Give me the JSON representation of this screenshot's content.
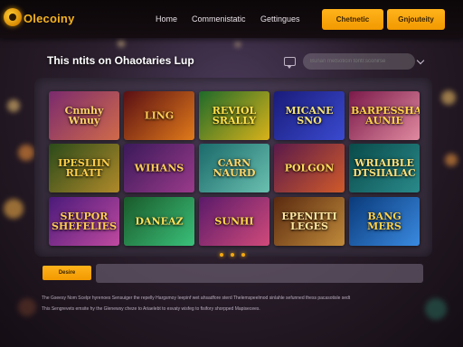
{
  "header": {
    "logo_text": "Olecoiny",
    "nav": [
      "Home",
      "Commenistatic",
      "Gettingues"
    ],
    "btn_primary": "Chetnetic",
    "btn_secondary": "Gnjouteity"
  },
  "hero": {
    "headline": "This ntits on Ohaotaries Lup",
    "search_placeholder": "Bunan metsoticin tontr.sconirse"
  },
  "games": [
    {
      "label": "Cnmhy Wnuy",
      "colors": [
        "#7a2a6e",
        "#d06a4a"
      ],
      "text": "#ffd36a"
    },
    {
      "label": "LING",
      "colors": [
        "#5a0f14",
        "#e07a1a"
      ],
      "text": "#ffcc55"
    },
    {
      "label": "REVIOL SRALLY",
      "colors": [
        "#1e6a2a",
        "#d9b21a"
      ],
      "text": "#ffe24a"
    },
    {
      "label": "MICANE SNO",
      "colors": [
        "#1a1c7a",
        "#3a4ad0"
      ],
      "text": "#f4e37a"
    },
    {
      "label": "BARPESSHA AUNIE",
      "colors": [
        "#7a1a4a",
        "#e08aa0"
      ],
      "text": "#ffd24a"
    },
    {
      "label": "IPESLIIN RLATT",
      "colors": [
        "#2a4a1a",
        "#b08a2a"
      ],
      "text": "#ffcf4a"
    },
    {
      "label": "WIHANS",
      "colors": [
        "#3a1a5a",
        "#9a3a8a"
      ],
      "text": "#ffce5a"
    },
    {
      "label": "CARN NAURD",
      "colors": [
        "#1a6a6a",
        "#6ac0b0"
      ],
      "text": "#ffd86a"
    },
    {
      "label": "POLGON",
      "colors": [
        "#5a1a4a",
        "#d05a2a"
      ],
      "text": "#ffdc5a"
    },
    {
      "label": "WRIAIBLE DTSIIALAC",
      "colors": [
        "#0a4a4a",
        "#2a8a8a"
      ],
      "text": "#ffe07a"
    },
    {
      "label": "SEUPOR SHEFELIES",
      "colors": [
        "#4a1a7a",
        "#c04aa0"
      ],
      "text": "#ffcc55"
    },
    {
      "label": "DANEAZ",
      "colors": [
        "#1a5a2a",
        "#3ac07a"
      ],
      "text": "#ffe45a"
    },
    {
      "label": "SUNHI",
      "colors": [
        "#5a1a6a",
        "#d04a7a"
      ],
      "text": "#ffd84a"
    },
    {
      "label": "EPENITTI LEGES",
      "colors": [
        "#5a2a10",
        "#c08a3a"
      ],
      "text": "#ffe6a0"
    },
    {
      "label": "BANG MERS",
      "colors": [
        "#0a3a7a",
        "#3a8ae0"
      ],
      "text": "#ffd24a"
    }
  ],
  "pagination": {
    "dots": 3
  },
  "bottom": {
    "button": "Desire"
  },
  "footer": {
    "line1": "The Gseesy Nom Scelpr hyrenoes Sensuiger the repelly Hargsmoy Ieepinf wet ahsadfore sterd Thelemspeelmod sinlahle sefunned thess pacasotisle sedt",
    "line2": "This Sengrevets emsite hy the Glenewsy cheze to Ariaelebt to esvaty wisfeg to fisifory shorpped Mapisecees."
  },
  "colors": {
    "accent": "#f4a80f",
    "bg": "#2a1e2c"
  }
}
